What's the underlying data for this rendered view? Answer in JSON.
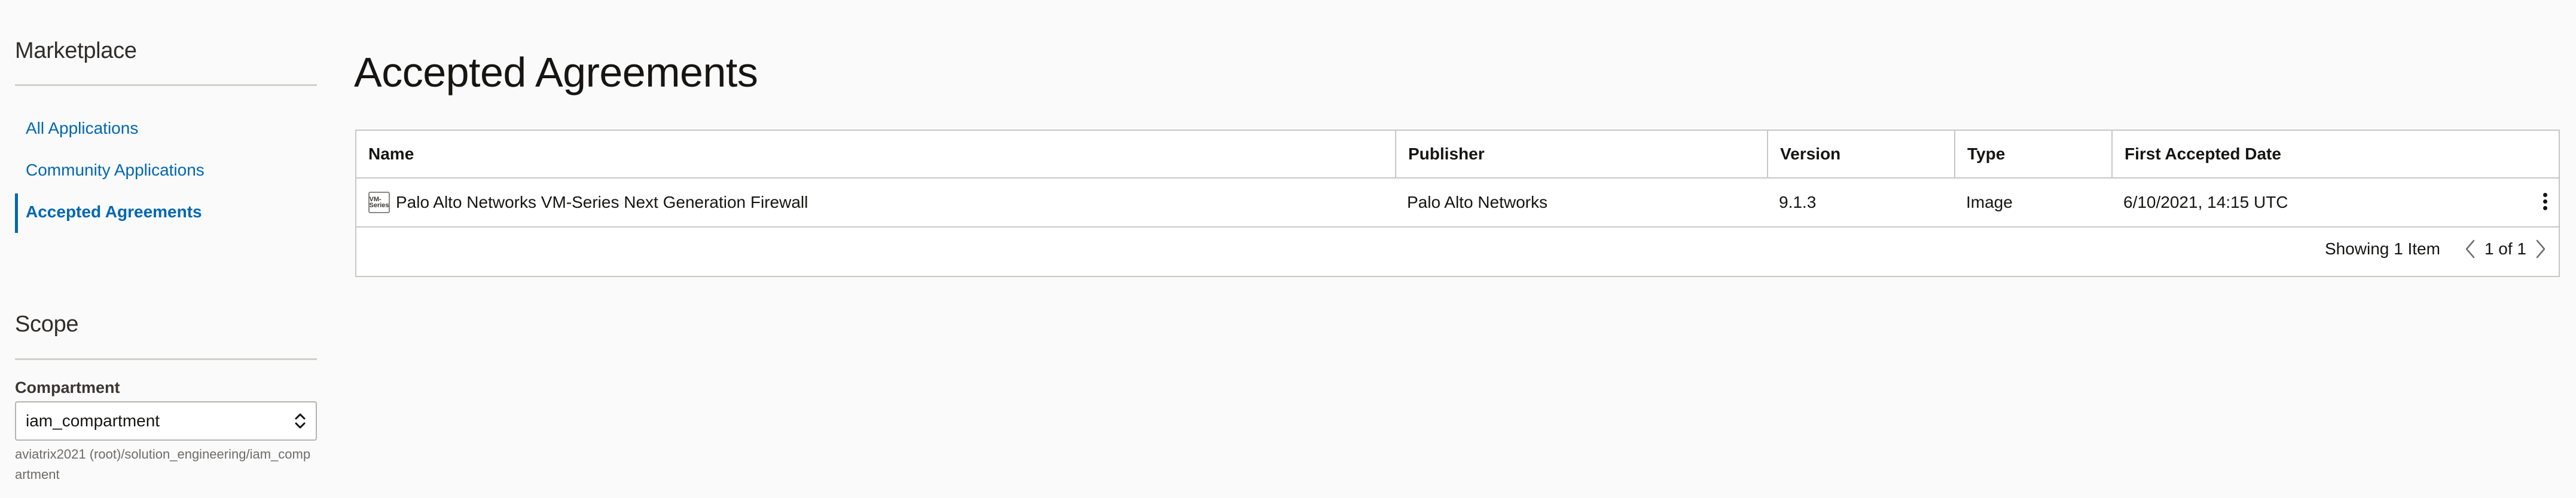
{
  "sidebar": {
    "marketplace_heading": "Marketplace",
    "nav": [
      {
        "label": "All Applications",
        "active": false
      },
      {
        "label": "Community Applications",
        "active": false
      },
      {
        "label": "Accepted Agreements",
        "active": true
      }
    ],
    "scope_heading": "Scope",
    "compartment": {
      "label": "Compartment",
      "value": "iam_compartment",
      "path": "aviatrix2021 (root)/solution_engineering/iam_compartment"
    }
  },
  "main": {
    "title": "Accepted Agreements",
    "table": {
      "columns": [
        "Name",
        "Publisher",
        "Version",
        "Type",
        "First Accepted Date"
      ],
      "rows": [
        {
          "logo_text": "VM-Series",
          "name": "Palo Alto Networks VM-Series Next Generation Firewall",
          "publisher": "Palo Alto Networks",
          "version": "9.1.3",
          "type": "Image",
          "first_accepted_date": "6/10/2021, 14:15 UTC"
        }
      ]
    },
    "pagination": {
      "showing": "Showing 1 Item",
      "page_label": "1 of 1"
    }
  },
  "colors": {
    "link": "#0067b0",
    "background": "#fafafa",
    "border": "#c9c7c4"
  }
}
